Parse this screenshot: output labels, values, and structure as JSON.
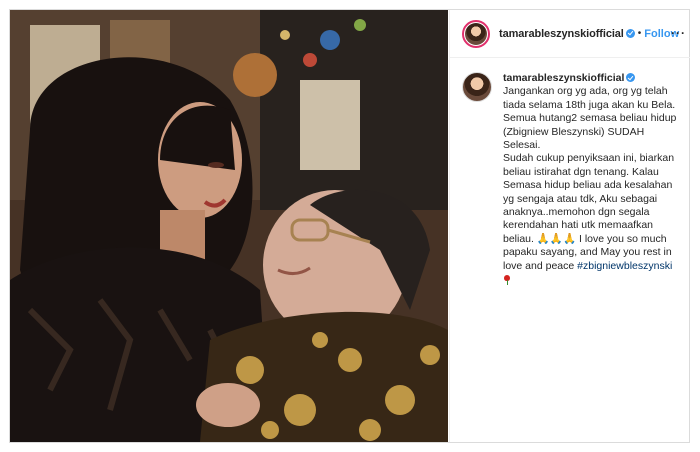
{
  "post": {
    "photo_alt": "",
    "header": {
      "username": "tamarableszynskiofficial",
      "separator": "•",
      "follow_label": "Follow",
      "more_label": "···"
    },
    "caption": {
      "username": "tamarableszynskiofficial",
      "lines": [
        "Jangankan org yg ada, org yg telah",
        "tiada selama 18th juga akan ku Bela.",
        "Semua hutang2 semasa beliau hidup",
        "(Zbigniew Bleszynski) SUDAH Selesai.",
        "Sudah cukup penyiksaan ini, biarkan",
        "beliau istirahat dgn tenang. Kalau",
        "Semasa hidup beliau ada kesalahan",
        "yg sengaja atau tdk, Aku sebagai",
        "anaknya..memohon dgn segala",
        "kerendahan hati utk memaafkan",
        "beliau. 🙏🙏🙏 I love you so much",
        "papaku sayang, and May you rest in",
        "love and peace"
      ],
      "hashtag": "#zbigniewbleszynski"
    }
  },
  "colors": {
    "link_blue": "#3897f0",
    "hashtag_blue": "#003569",
    "text": "#262626",
    "border": "#dbdbdb"
  },
  "icons": [
    "verified-badge-icon",
    "more-options-icon",
    "rose-emoji-icon",
    "praying-hands-emoji-icon"
  ]
}
